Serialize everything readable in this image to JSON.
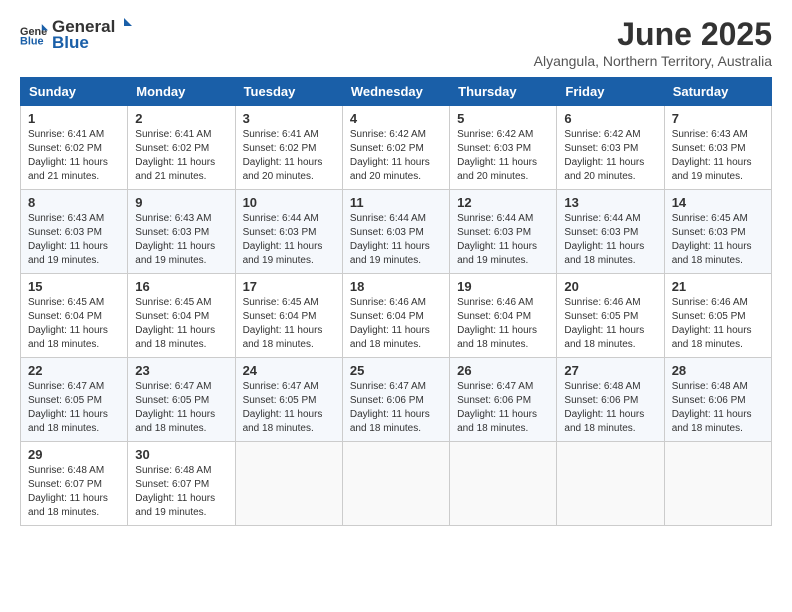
{
  "logo": {
    "general": "General",
    "blue": "Blue"
  },
  "title": "June 2025",
  "subtitle": "Alyangula, Northern Territory, Australia",
  "days_header": [
    "Sunday",
    "Monday",
    "Tuesday",
    "Wednesday",
    "Thursday",
    "Friday",
    "Saturday"
  ],
  "weeks": [
    [
      {
        "day": "1",
        "sunrise": "6:41 AM",
        "sunset": "6:02 PM",
        "daylight": "11 hours and 21 minutes."
      },
      {
        "day": "2",
        "sunrise": "6:41 AM",
        "sunset": "6:02 PM",
        "daylight": "11 hours and 21 minutes."
      },
      {
        "day": "3",
        "sunrise": "6:41 AM",
        "sunset": "6:02 PM",
        "daylight": "11 hours and 20 minutes."
      },
      {
        "day": "4",
        "sunrise": "6:42 AM",
        "sunset": "6:02 PM",
        "daylight": "11 hours and 20 minutes."
      },
      {
        "day": "5",
        "sunrise": "6:42 AM",
        "sunset": "6:03 PM",
        "daylight": "11 hours and 20 minutes."
      },
      {
        "day": "6",
        "sunrise": "6:42 AM",
        "sunset": "6:03 PM",
        "daylight": "11 hours and 20 minutes."
      },
      {
        "day": "7",
        "sunrise": "6:43 AM",
        "sunset": "6:03 PM",
        "daylight": "11 hours and 19 minutes."
      }
    ],
    [
      {
        "day": "8",
        "sunrise": "6:43 AM",
        "sunset": "6:03 PM",
        "daylight": "11 hours and 19 minutes."
      },
      {
        "day": "9",
        "sunrise": "6:43 AM",
        "sunset": "6:03 PM",
        "daylight": "11 hours and 19 minutes."
      },
      {
        "day": "10",
        "sunrise": "6:44 AM",
        "sunset": "6:03 PM",
        "daylight": "11 hours and 19 minutes."
      },
      {
        "day": "11",
        "sunrise": "6:44 AM",
        "sunset": "6:03 PM",
        "daylight": "11 hours and 19 minutes."
      },
      {
        "day": "12",
        "sunrise": "6:44 AM",
        "sunset": "6:03 PM",
        "daylight": "11 hours and 19 minutes."
      },
      {
        "day": "13",
        "sunrise": "6:44 AM",
        "sunset": "6:03 PM",
        "daylight": "11 hours and 18 minutes."
      },
      {
        "day": "14",
        "sunrise": "6:45 AM",
        "sunset": "6:03 PM",
        "daylight": "11 hours and 18 minutes."
      }
    ],
    [
      {
        "day": "15",
        "sunrise": "6:45 AM",
        "sunset": "6:04 PM",
        "daylight": "11 hours and 18 minutes."
      },
      {
        "day": "16",
        "sunrise": "6:45 AM",
        "sunset": "6:04 PM",
        "daylight": "11 hours and 18 minutes."
      },
      {
        "day": "17",
        "sunrise": "6:45 AM",
        "sunset": "6:04 PM",
        "daylight": "11 hours and 18 minutes."
      },
      {
        "day": "18",
        "sunrise": "6:46 AM",
        "sunset": "6:04 PM",
        "daylight": "11 hours and 18 minutes."
      },
      {
        "day": "19",
        "sunrise": "6:46 AM",
        "sunset": "6:04 PM",
        "daylight": "11 hours and 18 minutes."
      },
      {
        "day": "20",
        "sunrise": "6:46 AM",
        "sunset": "6:05 PM",
        "daylight": "11 hours and 18 minutes."
      },
      {
        "day": "21",
        "sunrise": "6:46 AM",
        "sunset": "6:05 PM",
        "daylight": "11 hours and 18 minutes."
      }
    ],
    [
      {
        "day": "22",
        "sunrise": "6:47 AM",
        "sunset": "6:05 PM",
        "daylight": "11 hours and 18 minutes."
      },
      {
        "day": "23",
        "sunrise": "6:47 AM",
        "sunset": "6:05 PM",
        "daylight": "11 hours and 18 minutes."
      },
      {
        "day": "24",
        "sunrise": "6:47 AM",
        "sunset": "6:05 PM",
        "daylight": "11 hours and 18 minutes."
      },
      {
        "day": "25",
        "sunrise": "6:47 AM",
        "sunset": "6:06 PM",
        "daylight": "11 hours and 18 minutes."
      },
      {
        "day": "26",
        "sunrise": "6:47 AM",
        "sunset": "6:06 PM",
        "daylight": "11 hours and 18 minutes."
      },
      {
        "day": "27",
        "sunrise": "6:48 AM",
        "sunset": "6:06 PM",
        "daylight": "11 hours and 18 minutes."
      },
      {
        "day": "28",
        "sunrise": "6:48 AM",
        "sunset": "6:06 PM",
        "daylight": "11 hours and 18 minutes."
      }
    ],
    [
      {
        "day": "29",
        "sunrise": "6:48 AM",
        "sunset": "6:07 PM",
        "daylight": "11 hours and 18 minutes."
      },
      {
        "day": "30",
        "sunrise": "6:48 AM",
        "sunset": "6:07 PM",
        "daylight": "11 hours and 19 minutes."
      },
      null,
      null,
      null,
      null,
      null
    ]
  ]
}
